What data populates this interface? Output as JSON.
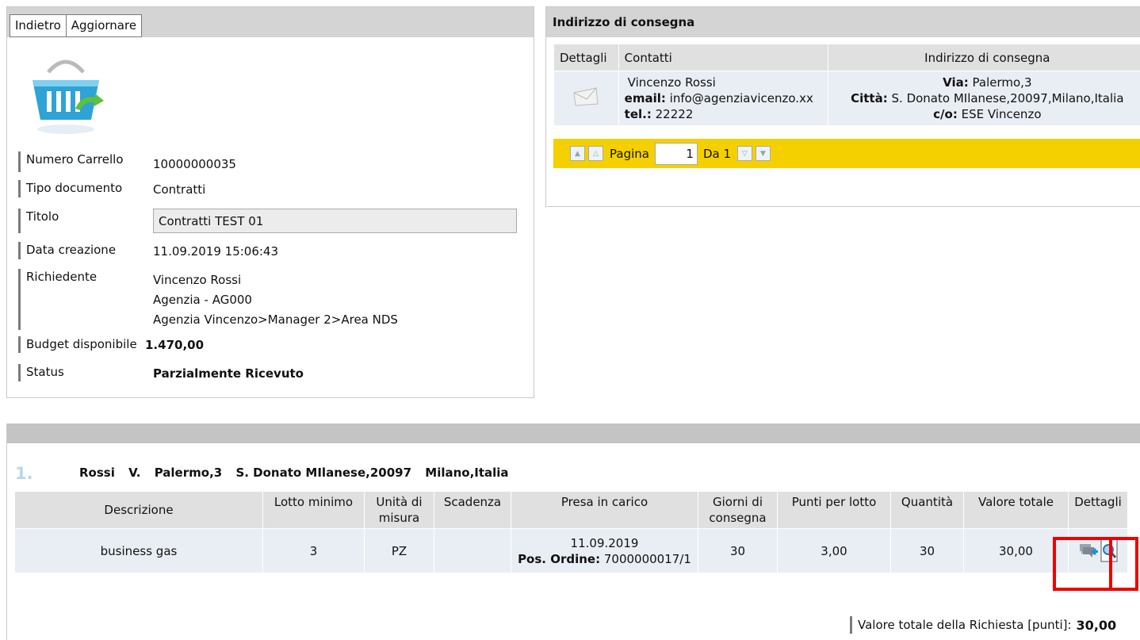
{
  "toolbar": {
    "back_label": "Indietro",
    "refresh_label": "Aggiornare"
  },
  "cart": {
    "numero_carrello_label": "Numero Carrello",
    "numero_carrello": "10000000035",
    "tipo_documento_label": "Tipo documento",
    "tipo_documento": "Contratti",
    "titolo_label": "Titolo",
    "titolo": "Contratti TEST 01",
    "data_creazione_label": "Data creazione",
    "data_creazione": "11.09.2019 15:06:43",
    "richiedente_label": "Richiedente",
    "richiedente_lines": [
      "Vincenzo Rossi",
      "Agenzia - AG000",
      "Agenzia Vincenzo>Manager 2>Area NDS"
    ],
    "budget_label": "Budget disponibile",
    "budget": "1.470,00",
    "status_label": "Status",
    "status": "Parzialmente Ricevuto"
  },
  "delivery": {
    "title": "Indirizzo di consegna",
    "headers": [
      "Dettagli",
      "Contatti",
      "Indirizzo di consegna"
    ],
    "contact_name": "Vincenzo Rossi",
    "email_label": "email:",
    "email": "info@agenziavicenzo.xx",
    "tel_label": "tel.:",
    "tel": "22222",
    "via_label": "Via:",
    "via": "Palermo,3",
    "citta_label": "Città:",
    "citta": "S. Donato MIlanese,20097,Milano,Italia",
    "co_label": "c/o:",
    "co": "ESE Vincenzo",
    "pager": {
      "page_label": "Pagina",
      "page": "1",
      "of_label": "Da 1"
    }
  },
  "order": {
    "group_number": "1.",
    "address_parts": [
      "Rossi",
      "V.",
      "Palermo,3",
      "S. Donato MIlanese,20097",
      "Milano,Italia"
    ],
    "headers": [
      "Descrizione",
      "Lotto minimo",
      "Unità di misura",
      "Scadenza",
      "Presa in carico",
      "Giorni di consegna",
      "Punti per lotto",
      "Quantità",
      "Valore totale",
      "Dettagli"
    ],
    "row": {
      "descrizione": "business gas",
      "lotto_minimo": "3",
      "unita": "PZ",
      "scadenza": "",
      "presa_date": "11.09.2019",
      "pos_label": "Pos. Ordine:",
      "pos_value": "7000000017/1",
      "giorni": "30",
      "punti": "3,00",
      "quantita": "30",
      "valore": "30,00"
    },
    "total_label": "Valore totale della Richiesta [punti]:",
    "total_value": "30,00"
  },
  "colors": {
    "pager_bg": "#f5d000",
    "highlight": "#e00000",
    "basket": "#2fa3d6",
    "arrow": "#5cc23a"
  }
}
